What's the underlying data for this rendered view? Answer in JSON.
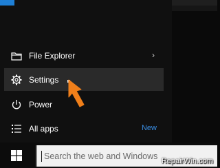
{
  "start_menu": {
    "items": [
      {
        "label": "File Explorer",
        "icon": "folder-icon"
      },
      {
        "label": "Settings",
        "icon": "gear-icon"
      },
      {
        "label": "Power",
        "icon": "power-icon"
      },
      {
        "label": "All apps",
        "icon": "list-icon"
      }
    ],
    "all_apps_badge": "New",
    "file_explorer_chevron": "›"
  },
  "taskbar": {
    "search_placeholder": "Search the web and Windows"
  },
  "watermark": "RepairWin.com",
  "colors": {
    "accent": "#1e7fd6",
    "highlight": "#2a2a2a",
    "new_badge": "#3a8fe6",
    "arrow": "#f07f1a"
  }
}
